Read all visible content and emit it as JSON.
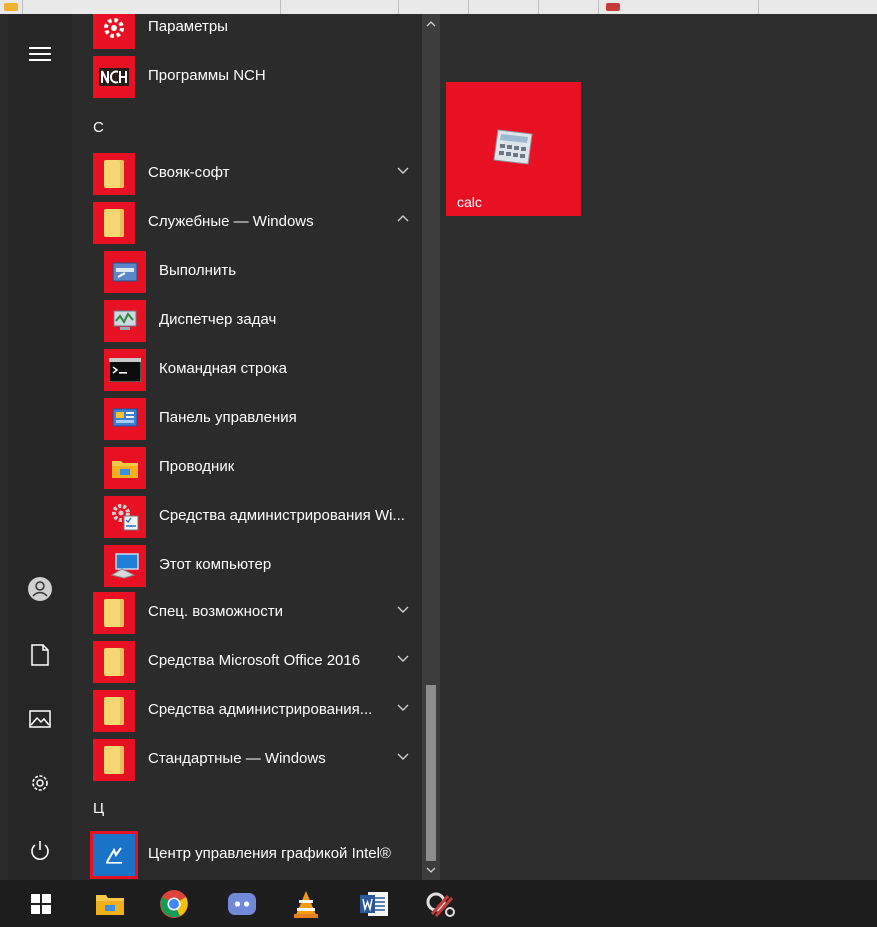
{
  "theme": {
    "accent": "#e81123",
    "folder": "#f7d774",
    "background": "#2b2b2b",
    "taskbar": "#1d1d1d"
  },
  "rail": {
    "menu_icon": "hamburger-icon",
    "buttons": [
      "user-icon",
      "documents-icon",
      "pictures-icon",
      "settings-icon",
      "power-icon"
    ]
  },
  "app_list": {
    "items": [
      {
        "label": "Параметры",
        "icon": "gear-icon"
      },
      {
        "label": "Программы NCH",
        "icon": "nch-icon"
      }
    ],
    "letter_c": "С",
    "groups_c": [
      {
        "label": "Свояк-софт",
        "icon": "folder-icon",
        "expanded": false
      },
      {
        "label": "Служебные — Windows",
        "icon": "folder-icon",
        "expanded": true
      }
    ],
    "subitems": [
      {
        "label": "Выполнить",
        "icon": "run-icon"
      },
      {
        "label": "Диспетчер задач",
        "icon": "task-manager-icon"
      },
      {
        "label": "Командная строка",
        "icon": "command-prompt-icon"
      },
      {
        "label": "Панель управления",
        "icon": "control-panel-icon"
      },
      {
        "label": "Проводник",
        "icon": "explorer-icon"
      },
      {
        "label": "Средства администрирования Wi...",
        "icon": "admin-tools-icon"
      },
      {
        "label": "Этот компьютер",
        "icon": "this-pc-icon"
      }
    ],
    "groups_after": [
      {
        "label": "Спец. возможности",
        "icon": "folder-icon",
        "expanded": false
      },
      {
        "label": "Средства Microsoft Office 2016",
        "icon": "folder-icon",
        "expanded": false
      },
      {
        "label": "Средства администрирования...",
        "icon": "folder-icon",
        "expanded": false
      },
      {
        "label": "Стандартные — Windows",
        "icon": "folder-icon",
        "expanded": false
      }
    ],
    "letter_ts": "Ц",
    "last_item": {
      "label": "Центр управления графикой Intel®",
      "icon": "intel-graphics-icon"
    }
  },
  "tiles": [
    {
      "label": "calc",
      "icon": "calculator-icon"
    }
  ],
  "taskbar": {
    "items": [
      "windows-start-icon",
      "file-explorer-icon",
      "chrome-icon",
      "discord-icon",
      "vlc-icon",
      "word-icon",
      "snipping-tool-icon"
    ]
  }
}
